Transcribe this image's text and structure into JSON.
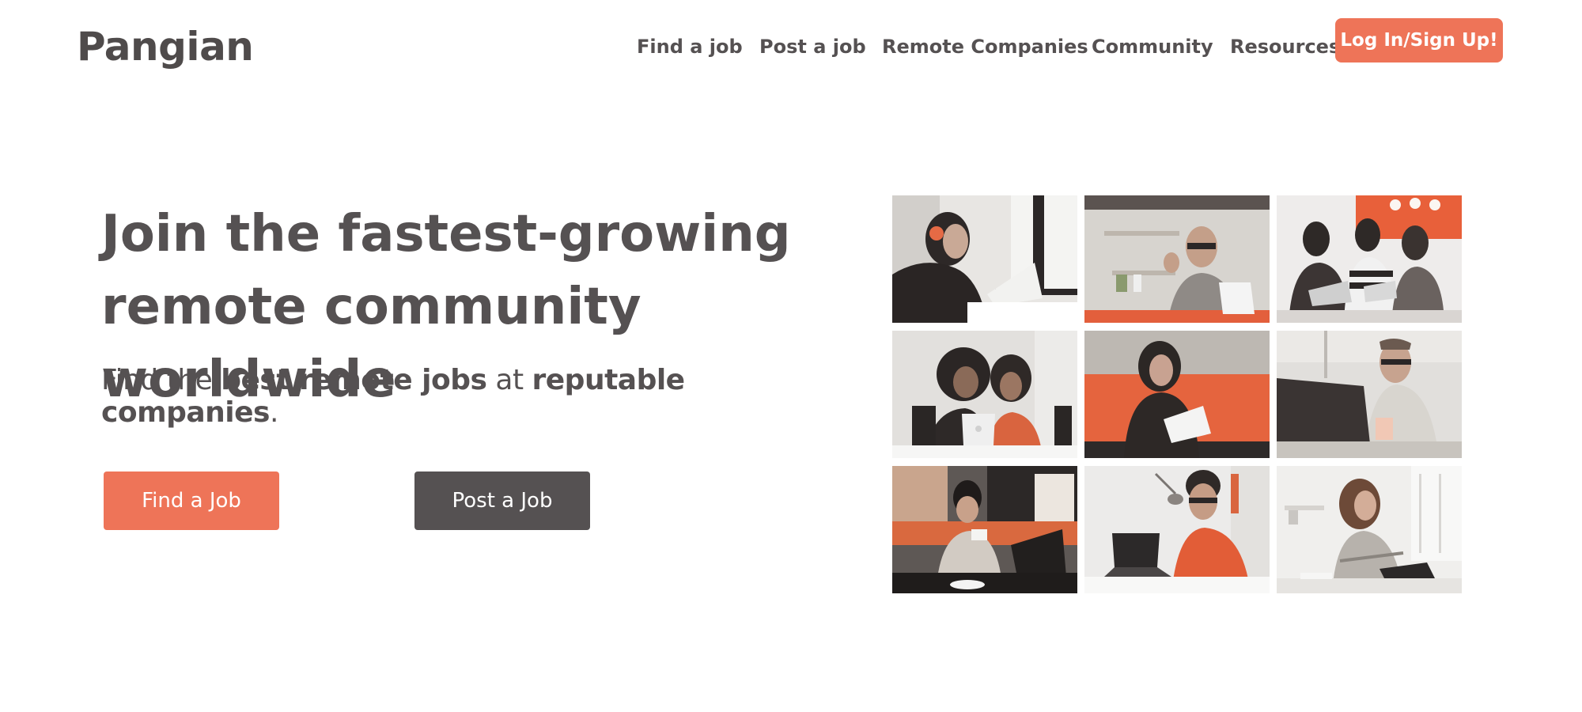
{
  "brand": {
    "name": "Pangian",
    "accent": "#ee7458",
    "dark": "#555152"
  },
  "nav": {
    "items": [
      "Find a job",
      "Post a job",
      "Remote Companies",
      "Community",
      "Resources"
    ],
    "login_label": "Log In/Sign Up!"
  },
  "hero": {
    "headline_line1": "Join the fastest-growing",
    "headline_line2": "remote community worldwide",
    "sub_prefix": "Find the ",
    "sub_bold1": "best remote jobs",
    "sub_mid": " at ",
    "sub_bold2": "reputable companies",
    "sub_suffix": ".",
    "find_button": "Find a Job",
    "post_button": "Post a Job"
  },
  "photos": [
    "woman-headphones-laptop",
    "man-waving-desk",
    "three-women-laptops",
    "two-women-laptop",
    "woman-orange-couch",
    "man-glasses-laptop",
    "woman-cafe-coffee",
    "man-orange-shirt-laptop",
    "woman-curly-hair-laptop"
  ]
}
